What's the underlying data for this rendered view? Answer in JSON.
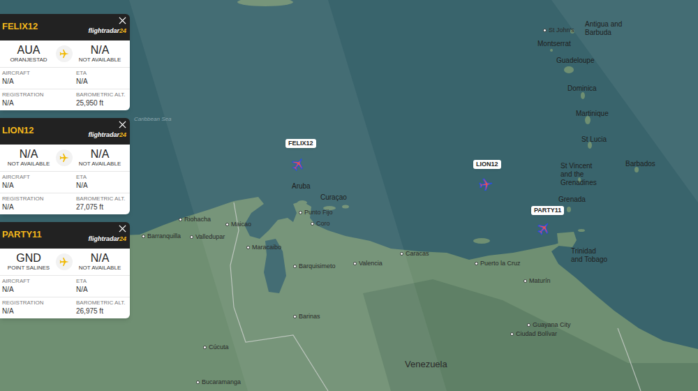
{
  "brand": {
    "text": "flightradar",
    "accent": "24"
  },
  "panels": [
    {
      "callsign": "FELIX12",
      "origin": {
        "code": "AUA",
        "name": "ORANJESTAD"
      },
      "destination": {
        "code": "N/A",
        "name": "NOT AVAILABLE"
      },
      "fields": [
        {
          "label": "AIRCRAFT",
          "value": "N/A"
        },
        {
          "label": "ETA",
          "value": "N/A"
        },
        {
          "label": "REGISTRATION",
          "value": "N/A"
        },
        {
          "label": "BAROMETRIC ALT.",
          "value": "25,950 ft"
        }
      ]
    },
    {
      "callsign": "LION12",
      "origin": {
        "code": "N/A",
        "name": "NOT AVAILABLE"
      },
      "destination": {
        "code": "N/A",
        "name": "NOT AVAILABLE"
      },
      "fields": [
        {
          "label": "AIRCRAFT",
          "value": "N/A"
        },
        {
          "label": "ETA",
          "value": "N/A"
        },
        {
          "label": "REGISTRATION",
          "value": "N/A"
        },
        {
          "label": "BAROMETRIC ALT.",
          "value": "27,075 ft"
        }
      ]
    },
    {
      "callsign": "PARTY11",
      "origin": {
        "code": "GND",
        "name": "POINT SALINES"
      },
      "destination": {
        "code": "N/A",
        "name": "NOT AVAILABLE"
      },
      "fields": [
        {
          "label": "AIRCRAFT",
          "value": "N/A"
        },
        {
          "label": "ETA",
          "value": "N/A"
        },
        {
          "label": "REGISTRATION",
          "value": "N/A"
        },
        {
          "label": "BAROMETRIC ALT.",
          "value": "26,975 ft"
        }
      ]
    }
  ],
  "map": {
    "aircraft": [
      {
        "callsign": "FELIX12"
      },
      {
        "callsign": "LION12"
      },
      {
        "callsign": "PARTY11"
      }
    ],
    "labels": [
      {
        "lines": [
          "Antigua and",
          "Barbuda"
        ],
        "kind": "place"
      },
      {
        "lines": [
          "St John's"
        ],
        "kind": "city"
      },
      {
        "lines": [
          "Montserrat"
        ],
        "kind": "place"
      },
      {
        "lines": [
          "Guadeloupe"
        ],
        "kind": "place"
      },
      {
        "lines": [
          "Dominica"
        ],
        "kind": "place"
      },
      {
        "lines": [
          "Martinique"
        ],
        "kind": "place"
      },
      {
        "lines": [
          "St Lucia"
        ],
        "kind": "place"
      },
      {
        "lines": [
          "Barbados"
        ],
        "kind": "place"
      },
      {
        "lines": [
          "St Vincent",
          "and the",
          "Grenadines"
        ],
        "kind": "place"
      },
      {
        "lines": [
          "Grenada"
        ],
        "kind": "place"
      },
      {
        "lines": [
          "Trinidad",
          "and Tobago"
        ],
        "kind": "place"
      },
      {
        "lines": [
          "Aruba"
        ],
        "kind": "place"
      },
      {
        "lines": [
          "Curaçao"
        ],
        "kind": "place"
      },
      {
        "lines": [
          "Punto Fijo"
        ],
        "kind": "city"
      },
      {
        "lines": [
          "Coro"
        ],
        "kind": "city"
      },
      {
        "lines": [
          "Caracas"
        ],
        "kind": "city"
      },
      {
        "lines": [
          "Barranquilla"
        ],
        "kind": "city"
      },
      {
        "lines": [
          "Riohacha"
        ],
        "kind": "city"
      },
      {
        "lines": [
          "Maicao"
        ],
        "kind": "city"
      },
      {
        "lines": [
          "Valledupar"
        ],
        "kind": "city"
      },
      {
        "lines": [
          "Maracaibo"
        ],
        "kind": "city"
      },
      {
        "lines": [
          "Barquisimeto"
        ],
        "kind": "city"
      },
      {
        "lines": [
          "Valencia"
        ],
        "kind": "city"
      },
      {
        "lines": [
          "Puerto la Cruz"
        ],
        "kind": "city"
      },
      {
        "lines": [
          "Maturín"
        ],
        "kind": "city"
      },
      {
        "lines": [
          "Barinas"
        ],
        "kind": "city"
      },
      {
        "lines": [
          "Cúcuta"
        ],
        "kind": "city"
      },
      {
        "lines": [
          "Bucaramanga"
        ],
        "kind": "city"
      },
      {
        "lines": [
          "Guayana City"
        ],
        "kind": "city"
      },
      {
        "lines": [
          "Ciudad Bolívar"
        ],
        "kind": "city"
      },
      {
        "lines": [
          "Venezuela"
        ],
        "kind": "country"
      },
      {
        "lines": [
          "Caribbean Sea"
        ],
        "kind": "water"
      }
    ]
  }
}
